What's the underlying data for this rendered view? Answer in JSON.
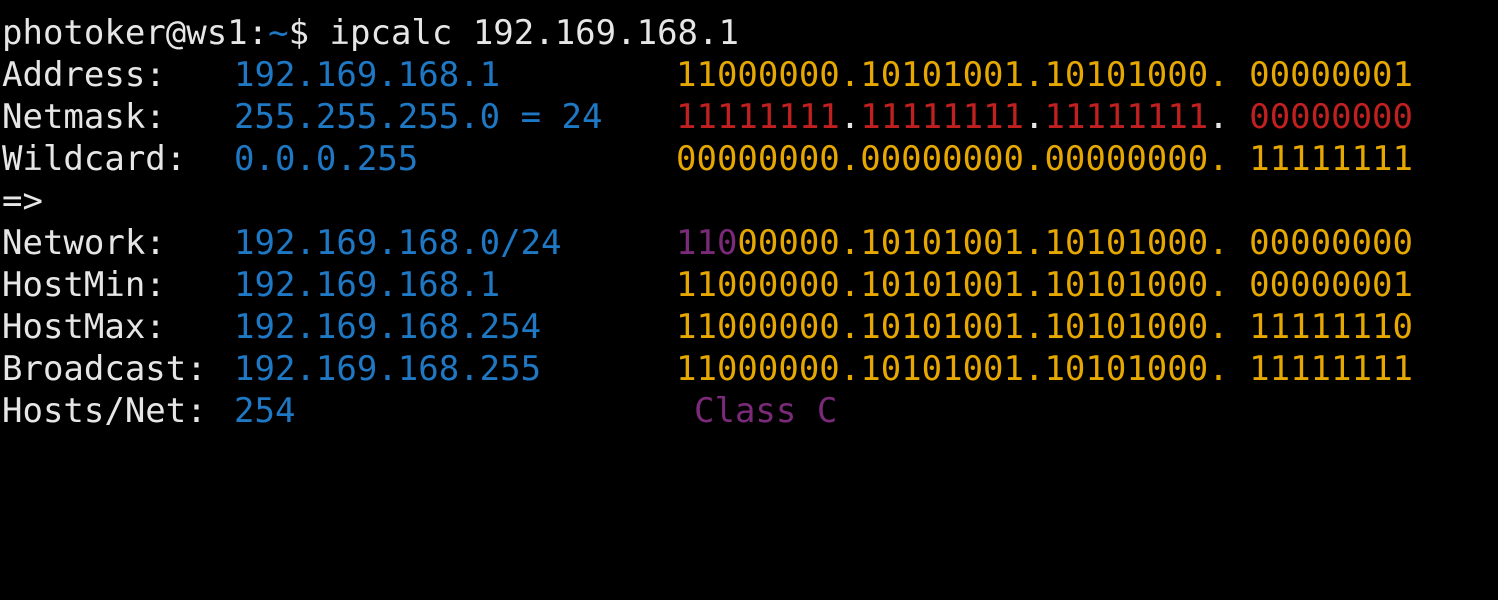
{
  "colors": {
    "background": "#000000",
    "text": "#e6e6e6",
    "value_blue": "#1f78c4",
    "binary_yellow": "#e6a800",
    "netmask_red": "#c02020",
    "network_purple": "#7a2a78",
    "class_purple": "#7a2a78",
    "prompt_tilde": "#1f78c4"
  },
  "prompt": {
    "user_host": "photoker@ws1:",
    "tilde": "~",
    "dollar": "$ ",
    "command": "ipcalc 192.169.168.1"
  },
  "rows": {
    "address": {
      "label": "Address:",
      "value": "192.169.168.1",
      "binary": "11000000.10101001.10101000. 00000001"
    },
    "netmask": {
      "label": "Netmask:",
      "value": "255.255.255.0 = 24",
      "binary_a": "11111111",
      "dot1": ".",
      "binary_b": "11111111",
      "dot2": ".",
      "binary_c": "11111111",
      "dot3": ". ",
      "binary_d": "00000000"
    },
    "wildcard": {
      "label": "Wildcard:",
      "value": "0.0.0.255",
      "binary": "00000000.00000000.00000000. 11111111"
    },
    "arrow": "=>",
    "network": {
      "label": "Network:",
      "value": "192.169.168.0/24",
      "binary_class_bits": "110",
      "binary_rest": "00000.10101001.10101000. 00000000"
    },
    "hostmin": {
      "label": "HostMin:",
      "value": "192.169.168.1",
      "binary": "11000000.10101001.10101000. 00000001"
    },
    "hostmax": {
      "label": "HostMax:",
      "value": "192.169.168.254",
      "binary": "11000000.10101001.10101000. 11111110"
    },
    "broadcast": {
      "label": "Broadcast:",
      "value": "192.169.168.255",
      "binary": "11000000.10101001.10101000. 11111111"
    },
    "hosts": {
      "label": "Hosts/Net:",
      "value": "254",
      "class": "Class C"
    }
  }
}
